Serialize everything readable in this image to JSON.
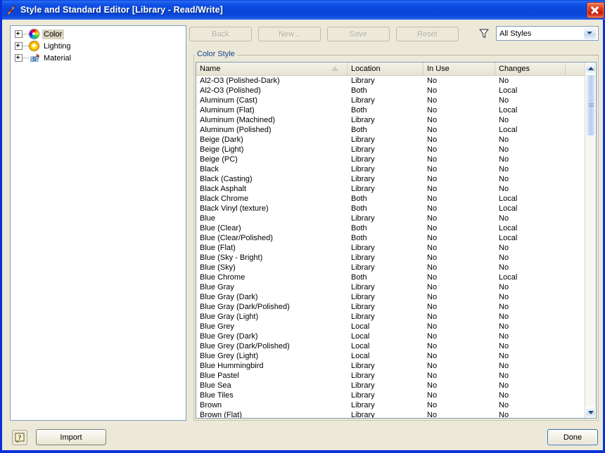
{
  "window": {
    "title": "Style and Standard Editor [Library - Read/Write]",
    "title_icon": "style-editor-icon",
    "close_icon": "close-icon",
    "titlebar_color": "#0a47db",
    "chrome_color": "#ece9d8"
  },
  "tree": {
    "items": [
      {
        "label": "Color",
        "icon": "color-wheel-icon",
        "expander": "plus-icon",
        "selected": true
      },
      {
        "label": "Lighting",
        "icon": "lighting-sun-icon",
        "expander": "plus-icon",
        "selected": false
      },
      {
        "label": "Material",
        "icon": "material-atom-icon",
        "expander": "plus-icon",
        "selected": false
      }
    ]
  },
  "toolbar": {
    "back_label": "Back",
    "new_label": "New...",
    "save_label": "Save",
    "reset_label": "Reset",
    "all_disabled": true
  },
  "filter": {
    "icon": "funnel-filter-icon",
    "selected": "All Styles",
    "options": [
      "All Styles"
    ]
  },
  "group": {
    "label": "Color Style",
    "label_color": "#15428b"
  },
  "list": {
    "columns": [
      {
        "label": "Name",
        "sorted": "ascending"
      },
      {
        "label": "Location",
        "sorted": ""
      },
      {
        "label": "In Use",
        "sorted": ""
      },
      {
        "label": "Changes",
        "sorted": ""
      }
    ],
    "rows": [
      {
        "name": "Al2-O3 (Polished-Dark)",
        "location": "Library",
        "in_use": "No",
        "changes": "No"
      },
      {
        "name": "Al2-O3 (Polished)",
        "location": "Both",
        "in_use": "No",
        "changes": "Local"
      },
      {
        "name": "Aluminum (Cast)",
        "location": "Library",
        "in_use": "No",
        "changes": "No"
      },
      {
        "name": "Aluminum (Flat)",
        "location": "Both",
        "in_use": "No",
        "changes": "Local"
      },
      {
        "name": "Aluminum (Machined)",
        "location": "Library",
        "in_use": "No",
        "changes": "No"
      },
      {
        "name": "Aluminum (Polished)",
        "location": "Both",
        "in_use": "No",
        "changes": "Local"
      },
      {
        "name": "Beige (Dark)",
        "location": "Library",
        "in_use": "No",
        "changes": "No"
      },
      {
        "name": "Beige (Light)",
        "location": "Library",
        "in_use": "No",
        "changes": "No"
      },
      {
        "name": "Beige (PC)",
        "location": "Library",
        "in_use": "No",
        "changes": "No"
      },
      {
        "name": "Black",
        "location": "Library",
        "in_use": "No",
        "changes": "No"
      },
      {
        "name": "Black (Casting)",
        "location": "Library",
        "in_use": "No",
        "changes": "No"
      },
      {
        "name": "Black Asphalt",
        "location": "Library",
        "in_use": "No",
        "changes": "No"
      },
      {
        "name": "Black Chrome",
        "location": "Both",
        "in_use": "No",
        "changes": "Local"
      },
      {
        "name": "Black Vinyl (texture)",
        "location": "Both",
        "in_use": "No",
        "changes": "Local"
      },
      {
        "name": "Blue",
        "location": "Library",
        "in_use": "No",
        "changes": "No"
      },
      {
        "name": "Blue (Clear)",
        "location": "Both",
        "in_use": "No",
        "changes": "Local"
      },
      {
        "name": "Blue (Clear/Polished)",
        "location": "Both",
        "in_use": "No",
        "changes": "Local"
      },
      {
        "name": "Blue (Flat)",
        "location": "Library",
        "in_use": "No",
        "changes": "No"
      },
      {
        "name": "Blue (Sky - Bright)",
        "location": "Library",
        "in_use": "No",
        "changes": "No"
      },
      {
        "name": "Blue (Sky)",
        "location": "Library",
        "in_use": "No",
        "changes": "No"
      },
      {
        "name": "Blue Chrome",
        "location": "Both",
        "in_use": "No",
        "changes": "Local"
      },
      {
        "name": "Blue Gray",
        "location": "Library",
        "in_use": "No",
        "changes": "No"
      },
      {
        "name": "Blue Gray (Dark)",
        "location": "Library",
        "in_use": "No",
        "changes": "No"
      },
      {
        "name": "Blue Gray (Dark/Polished)",
        "location": "Library",
        "in_use": "No",
        "changes": "No"
      },
      {
        "name": "Blue Gray (Light)",
        "location": "Library",
        "in_use": "No",
        "changes": "No"
      },
      {
        "name": "Blue Grey",
        "location": "Local",
        "in_use": "No",
        "changes": "No"
      },
      {
        "name": "Blue Grey (Dark)",
        "location": "Local",
        "in_use": "No",
        "changes": "No"
      },
      {
        "name": "Blue Grey (Dark/Polished)",
        "location": "Local",
        "in_use": "No",
        "changes": "No"
      },
      {
        "name": "Blue Grey (Light)",
        "location": "Local",
        "in_use": "No",
        "changes": "No"
      },
      {
        "name": "Blue Hummingbird",
        "location": "Library",
        "in_use": "No",
        "changes": "No"
      },
      {
        "name": "Blue Pastel",
        "location": "Library",
        "in_use": "No",
        "changes": "No"
      },
      {
        "name": "Blue Sea",
        "location": "Library",
        "in_use": "No",
        "changes": "No"
      },
      {
        "name": "Blue Tiles",
        "location": "Library",
        "in_use": "No",
        "changes": "No"
      },
      {
        "name": "Brown",
        "location": "Library",
        "in_use": "No",
        "changes": "No"
      },
      {
        "name": "Brown (Flat)",
        "location": "Library",
        "in_use": "No",
        "changes": "No"
      }
    ],
    "scrollbar": {
      "up_icon": "scroll-up-icon",
      "down_icon": "scroll-down-icon",
      "thumb_grip_icon": "scrollbar-grip-icon"
    }
  },
  "footer": {
    "help_label": "?",
    "help_icon": "help-question-icon",
    "import_label": "Import",
    "done_label": "Done"
  }
}
